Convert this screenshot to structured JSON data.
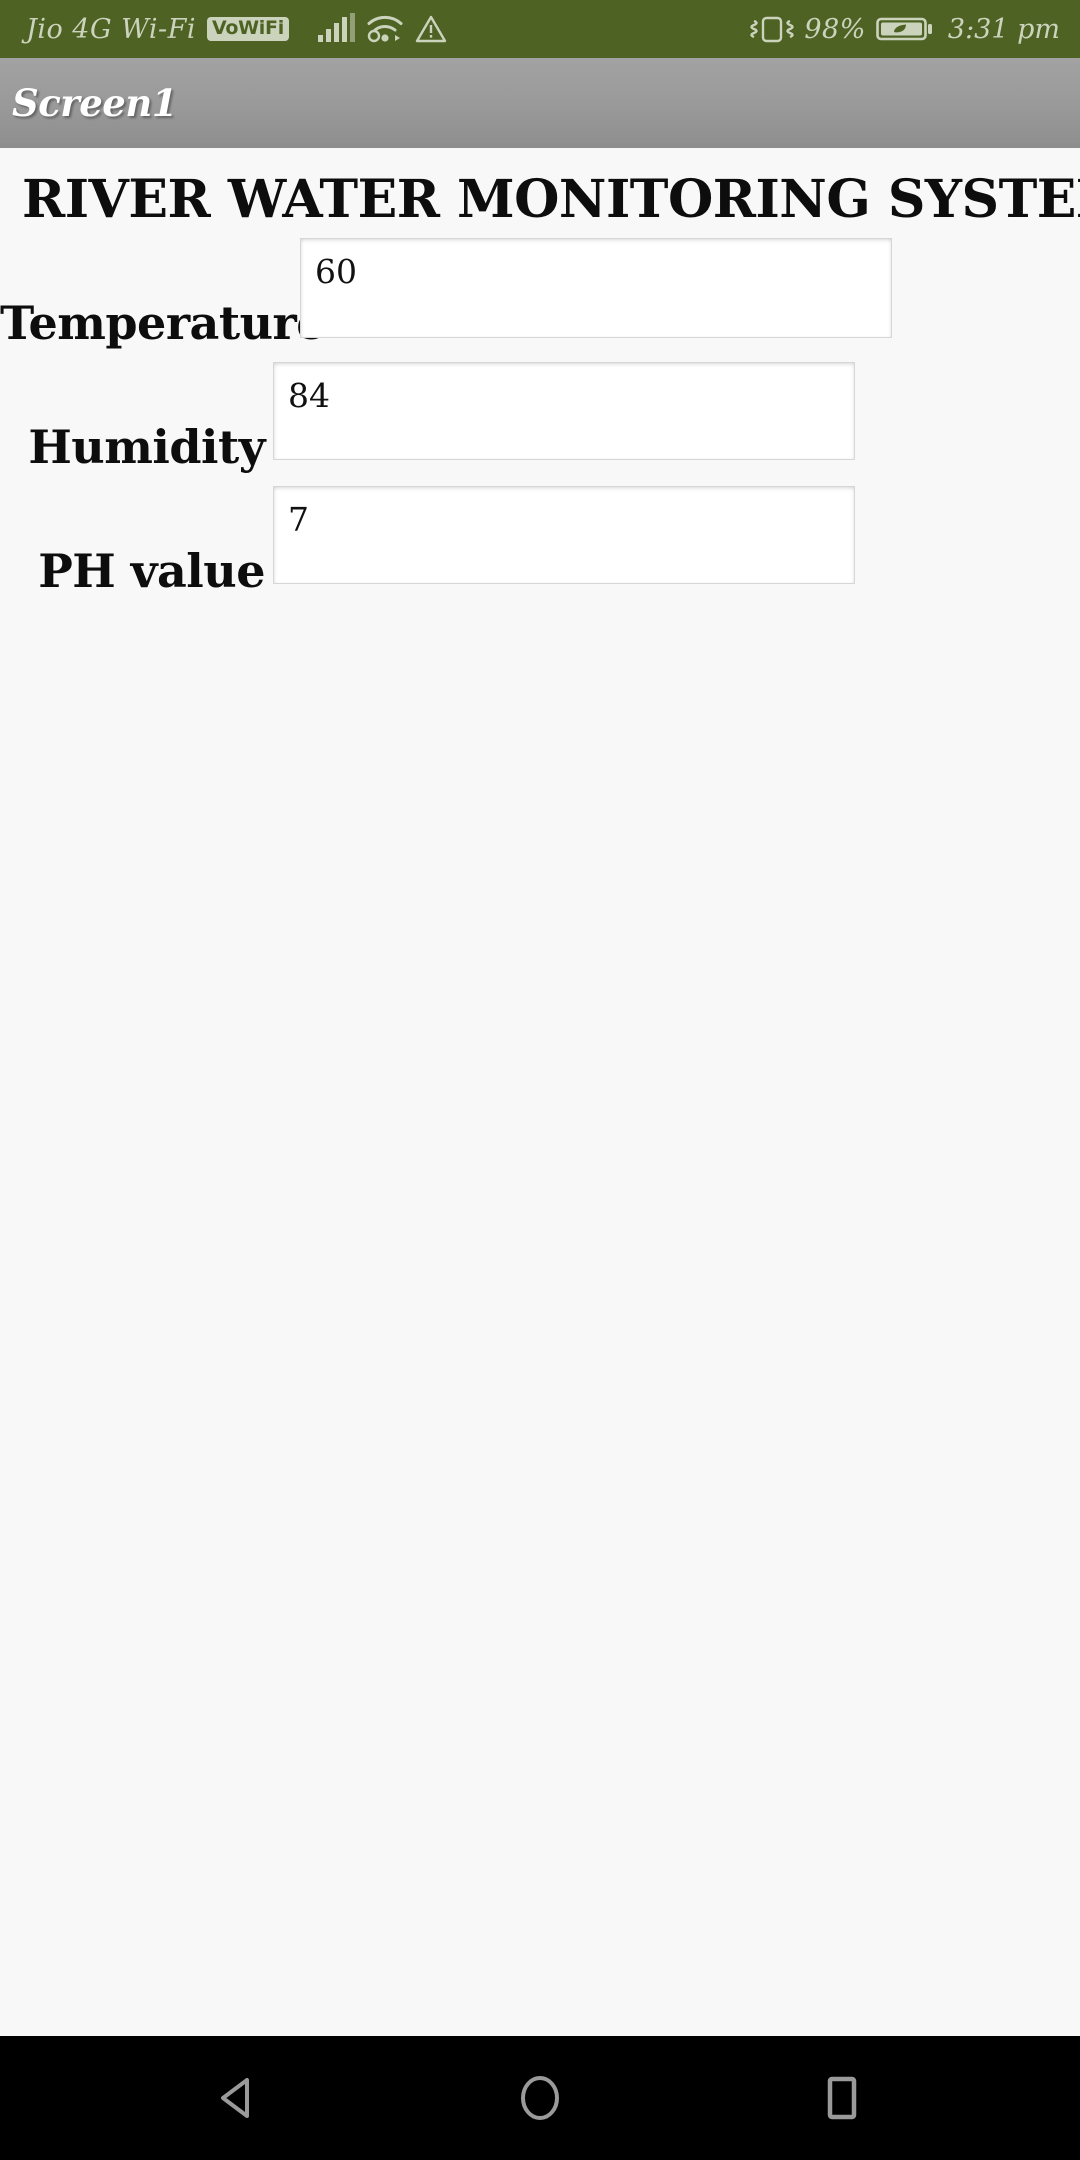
{
  "status_bar": {
    "background_color": "#4e6323",
    "foreground_color": "#ccd3bd",
    "carrier": "Jio 4G Wi-Fi",
    "vowifi_badge": "VoWiFi",
    "signal_icon": "signal-bars-icon",
    "wifi_icon": "wifi-icon",
    "warning_icon": "warning-triangle-icon",
    "vibrate_icon": "vibrate-icon",
    "battery_percent": "98%",
    "battery_icon": "battery-powersave-leaf-icon",
    "time": "3:31 pm"
  },
  "title_bar": {
    "title": "Screen1",
    "background_color": "#999999",
    "text_color": "#ffffff"
  },
  "screen": {
    "heading": "RIVER WATER MONITORING SYSTEM",
    "background_color": "#f8f8f8",
    "text_color": "#0d0d0d",
    "fields": [
      {
        "label": "Temperature",
        "value": "60",
        "placeholder": ""
      },
      {
        "label": "Humidity",
        "value": "84",
        "placeholder": ""
      },
      {
        "label": "PH value",
        "value": "7",
        "placeholder": ""
      }
    ]
  },
  "nav_bar": {
    "background_color": "#000000",
    "icon_color": "#9a9a9a",
    "back_icon": "back-triangle-icon",
    "home_icon": "home-circle-icon",
    "recents_icon": "recents-square-icon"
  }
}
